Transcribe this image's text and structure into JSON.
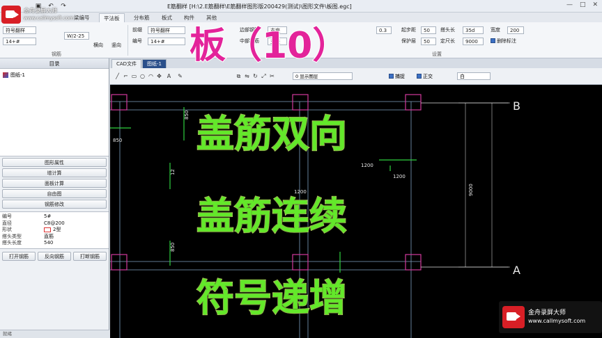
{
  "window": {
    "title": "E筋翻样  [H:\\2.E筋翻样\\E筋翻样图形版20042​9(测试)\\图形文件\\板图.egc]",
    "minimize": "—",
    "maximize": "□",
    "close": "✕"
  },
  "recorder_top": {
    "brand": "金舟录屏大师",
    "url": "www.callmysoft.com"
  },
  "ribbon": {
    "tabs": [
      "梁编号",
      "平法板",
      "分布筋",
      "板式",
      "构件",
      "其他"
    ],
    "active_tab": "平法板",
    "fields": {
      "dir_value": "W/2-25",
      "type_select": "符号翻样",
      "number_value": "14+#",
      "left_select": "14+#",
      "prefix_label": "前缀",
      "number_label": "编号",
      "edge_label": "边部钢筋",
      "edge_value": "支座",
      "middle_label": "中部钢筋",
      "middle_value": "支座",
      "value_03": "0.3",
      "start_label": "起步距",
      "start_value": "50",
      "protect_label": "保护层",
      "protect_value": "50",
      "anchor_label": "搭头长",
      "anchor_value": "35d",
      "length_label": "定尺长",
      "length_value": "9000",
      "width_label": "宽度",
      "width_value": "200",
      "delete_mark_label": "删除标注"
    },
    "group_labels": {
      "g1": "钢筋",
      "g2": "设置"
    },
    "btn_draw_x": "横向",
    "btn_draw_y": "竖向"
  },
  "left_panel": {
    "header": "目录",
    "tree_item": "图纸-1",
    "buttons": [
      "图形属性",
      "增计算",
      "面板计算",
      "自由图",
      "钢筋修改"
    ],
    "props": [
      {
        "key": "编号",
        "value": "5#"
      },
      {
        "key": "直径",
        "value": "C8@200"
      },
      {
        "key": "形状",
        "value": "2型"
      },
      {
        "key": "搭头类型",
        "value": "直筋"
      },
      {
        "key": "搭头长度",
        "value": "540"
      }
    ],
    "bottom_buttons": [
      "打开钢筋",
      "反向钢筋",
      "打断钢筋"
    ],
    "status": "就绪"
  },
  "canvas": {
    "doc_tabs": [
      "CAD文件",
      "图纸-1"
    ],
    "active_doc_tab": "图纸-1",
    "layer_select": "0 显示图层",
    "toolbar_labels": {
      "cross": "捕捉",
      "ortho": "正交",
      "white": "白"
    },
    "axis_labels": [
      "B",
      "A"
    ],
    "dim_labels": [
      "850",
      "850",
      "1200",
      "9000",
      "1200",
      "1200",
      "12",
      "850"
    ]
  },
  "overlay": {
    "title": "板（10）",
    "line1": "盖筋双向",
    "line2": "盖筋连续",
    "line3": "符号递增"
  },
  "recorder_bottom": {
    "brand": "金舟录屏大师",
    "url": "www.callmysoft.com"
  }
}
